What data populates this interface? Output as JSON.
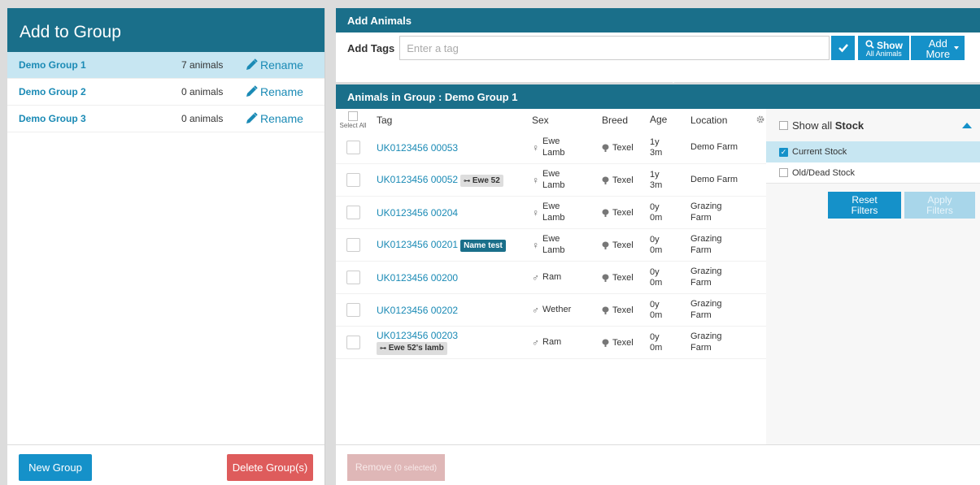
{
  "left": {
    "title": "Add to Group",
    "groups": [
      {
        "name": "Demo Group 1",
        "count": "7 animals",
        "action": "Rename"
      },
      {
        "name": "Demo Group 2",
        "count": "0 animals",
        "action": "Rename"
      },
      {
        "name": "Demo Group 3",
        "count": "0 animals",
        "action": "Rename"
      }
    ],
    "new_group": "New Group",
    "delete_group": "Delete Group(s)"
  },
  "add_animals": {
    "title": "Add Animals",
    "tags_label": "Add Tags",
    "tags_placeholder": "Enter a tag",
    "show_line1": "Show",
    "show_line2": "All Animals",
    "add_line1": "Add",
    "add_line2": "More"
  },
  "group_table": {
    "title": "Animals in Group : Demo Group 1",
    "select_all": "Select All",
    "headers": {
      "tag": "Tag",
      "sex": "Sex",
      "breed": "Breed",
      "age": "Age",
      "location": "Location"
    },
    "rows": [
      {
        "tag": "UK0123456 00053",
        "badge": "",
        "sex_symbol": "♀",
        "sex_l1": "Ewe",
        "sex_l2": "Lamb",
        "breed": "Texel",
        "age_l1": "1y",
        "age_l2": "3m",
        "loc_l1": "Demo Farm",
        "loc_l2": ""
      },
      {
        "tag": "UK0123456 00052",
        "badge": "Ewe 52",
        "sex_symbol": "♀",
        "sex_l1": "Ewe",
        "sex_l2": "Lamb",
        "breed": "Texel",
        "age_l1": "1y",
        "age_l2": "3m",
        "loc_l1": "Demo Farm",
        "loc_l2": ""
      },
      {
        "tag": "UK0123456 00204",
        "badge": "",
        "sex_symbol": "♀",
        "sex_l1": "Ewe",
        "sex_l2": "Lamb",
        "breed": "Texel",
        "age_l1": "0y",
        "age_l2": "0m",
        "loc_l1": "Grazing",
        "loc_l2": "Farm"
      },
      {
        "tag": "UK0123456 00201",
        "badge": "Name test",
        "sex_symbol": "♀",
        "sex_l1": "Ewe",
        "sex_l2": "Lamb",
        "breed": "Texel",
        "age_l1": "0y",
        "age_l2": "0m",
        "loc_l1": "Grazing",
        "loc_l2": "Farm"
      },
      {
        "tag": "UK0123456 00200",
        "badge": "",
        "sex_symbol": "♂",
        "sex_l1": "Ram",
        "sex_l2": "",
        "breed": "Texel",
        "age_l1": "0y",
        "age_l2": "0m",
        "loc_l1": "Grazing",
        "loc_l2": "Farm"
      },
      {
        "tag": "UK0123456 00202",
        "badge": "",
        "sex_symbol": "♂",
        "sex_l1": "Wether",
        "sex_l2": "",
        "breed": "Texel",
        "age_l1": "0y",
        "age_l2": "0m",
        "loc_l1": "Grazing",
        "loc_l2": "Farm"
      },
      {
        "tag": "UK0123456 00203",
        "badge": "Ewe 52's lamb",
        "sex_symbol": "♂",
        "sex_l1": "Ram",
        "sex_l2": "",
        "breed": "Texel",
        "age_l1": "0y",
        "age_l2": "0m",
        "loc_l1": "Grazing",
        "loc_l2": "Farm"
      }
    ],
    "remove_label": "Remove",
    "remove_count": "(0 selected)"
  },
  "filters": {
    "show_all_prefix": "Show all",
    "show_all_bold": "Stock",
    "options": [
      {
        "label": "Current Stock",
        "checked": true
      },
      {
        "label": "Old/Dead Stock",
        "checked": false
      }
    ],
    "reset_l1": "Reset",
    "reset_l2": "Filters",
    "apply_l1": "Apply",
    "apply_l2": "Filters"
  },
  "colors": {
    "header": "#1a6f8a",
    "accent": "#1591c9",
    "danger": "#de5c5c",
    "selected_row": "#c7e6f2"
  }
}
